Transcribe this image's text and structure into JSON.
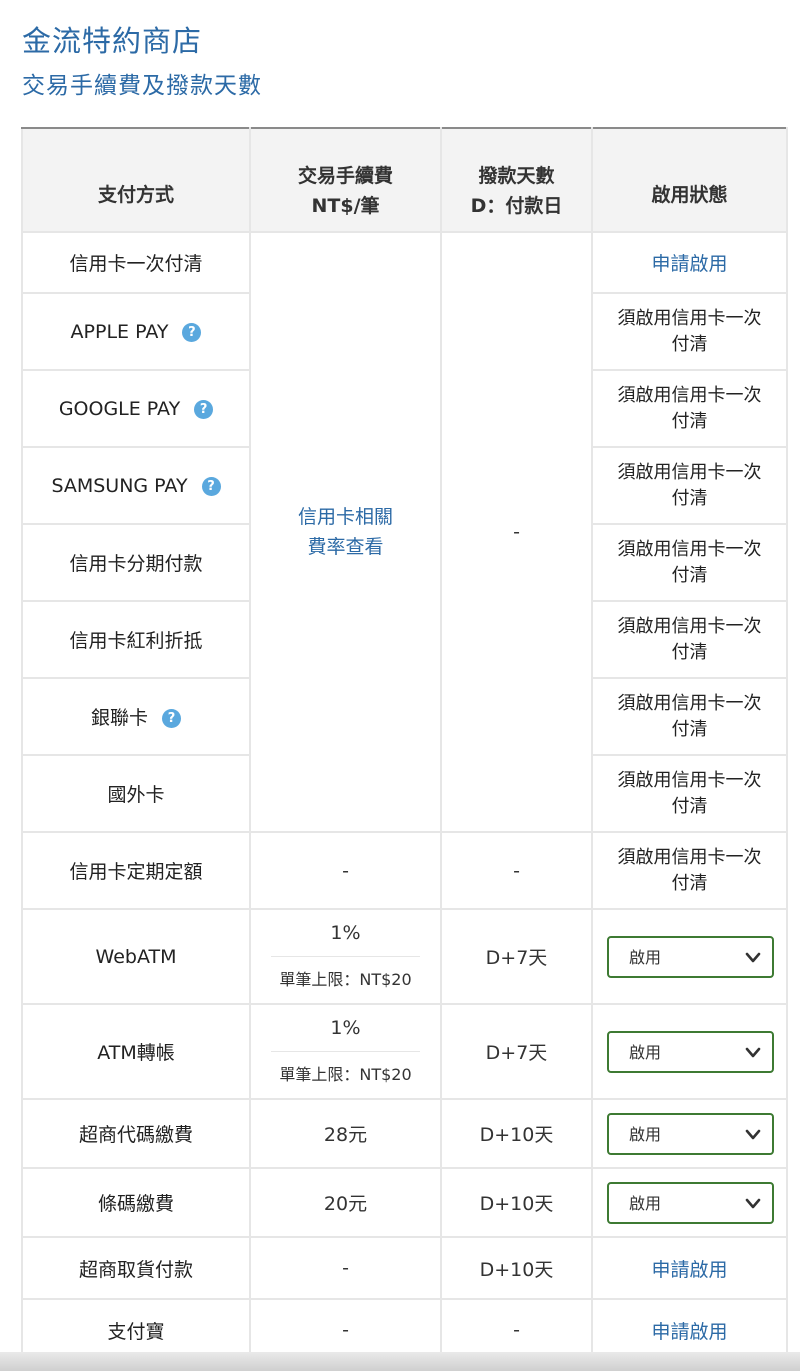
{
  "header": {
    "title": "金流特約商店",
    "subtitle": "交易手續費及撥款天數"
  },
  "table": {
    "headers": {
      "method": "支付方式",
      "fee_line1": "交易手續費",
      "fee_line2": "NT$/筆",
      "days_line1": "撥款天數",
      "days_line2": "D：付款日",
      "status": "啟用狀態"
    },
    "credit_group": {
      "fee_link_line1": "信用卡相關",
      "fee_link_line2": "費率查看",
      "days": "-",
      "rows": [
        {
          "name": "信用卡一次付清",
          "status": "申請啟用"
        },
        {
          "name": "APPLE PAY",
          "status": "須啟用信用卡一次付清"
        },
        {
          "name": "GOOGLE PAY",
          "status": "須啟用信用卡一次付清"
        },
        {
          "name": "SAMSUNG PAY",
          "status": "須啟用信用卡一次付清"
        },
        {
          "name": "信用卡分期付款",
          "status": "須啟用信用卡一次付清"
        },
        {
          "name": "信用卡紅利折抵",
          "status": "須啟用信用卡一次付清"
        },
        {
          "name": "銀聯卡",
          "status": "須啟用信用卡一次付清"
        },
        {
          "name": "國外卡",
          "status": "須啟用信用卡一次付清"
        }
      ]
    },
    "periodic": {
      "name": "信用卡定期定額",
      "fee": "-",
      "days": "-",
      "status": "須啟用信用卡一次付清"
    },
    "webatm": {
      "name": "WebATM",
      "fee": "1%",
      "fee_cap": "單筆上限：NT$20",
      "days": "D+7天",
      "status": "啟用"
    },
    "atm": {
      "name": "ATM轉帳",
      "fee": "1%",
      "fee_cap": "單筆上限：NT$20",
      "days": "D+7天",
      "status": "啟用"
    },
    "cvs_code": {
      "name": "超商代碼繳費",
      "fee": "28元",
      "days": "D+10天",
      "status": "啟用"
    },
    "barcode": {
      "name": "條碼繳費",
      "fee": "20元",
      "days": "D+10天",
      "status": "啟用"
    },
    "cvs_pickup": {
      "name": "超商取貨付款",
      "fee": "-",
      "days": "D+10天",
      "status": "申請啟用"
    },
    "alipay": {
      "name": "支付寶",
      "fee": "-",
      "days": "-",
      "status": "申請啟用"
    }
  },
  "icons": {
    "help": "help-circle-icon",
    "chevron": "chevron-down-icon"
  },
  "colors": {
    "link": "#2c6aa6",
    "help_icon": "#5aa8de",
    "select_border": "#3d7a32"
  }
}
